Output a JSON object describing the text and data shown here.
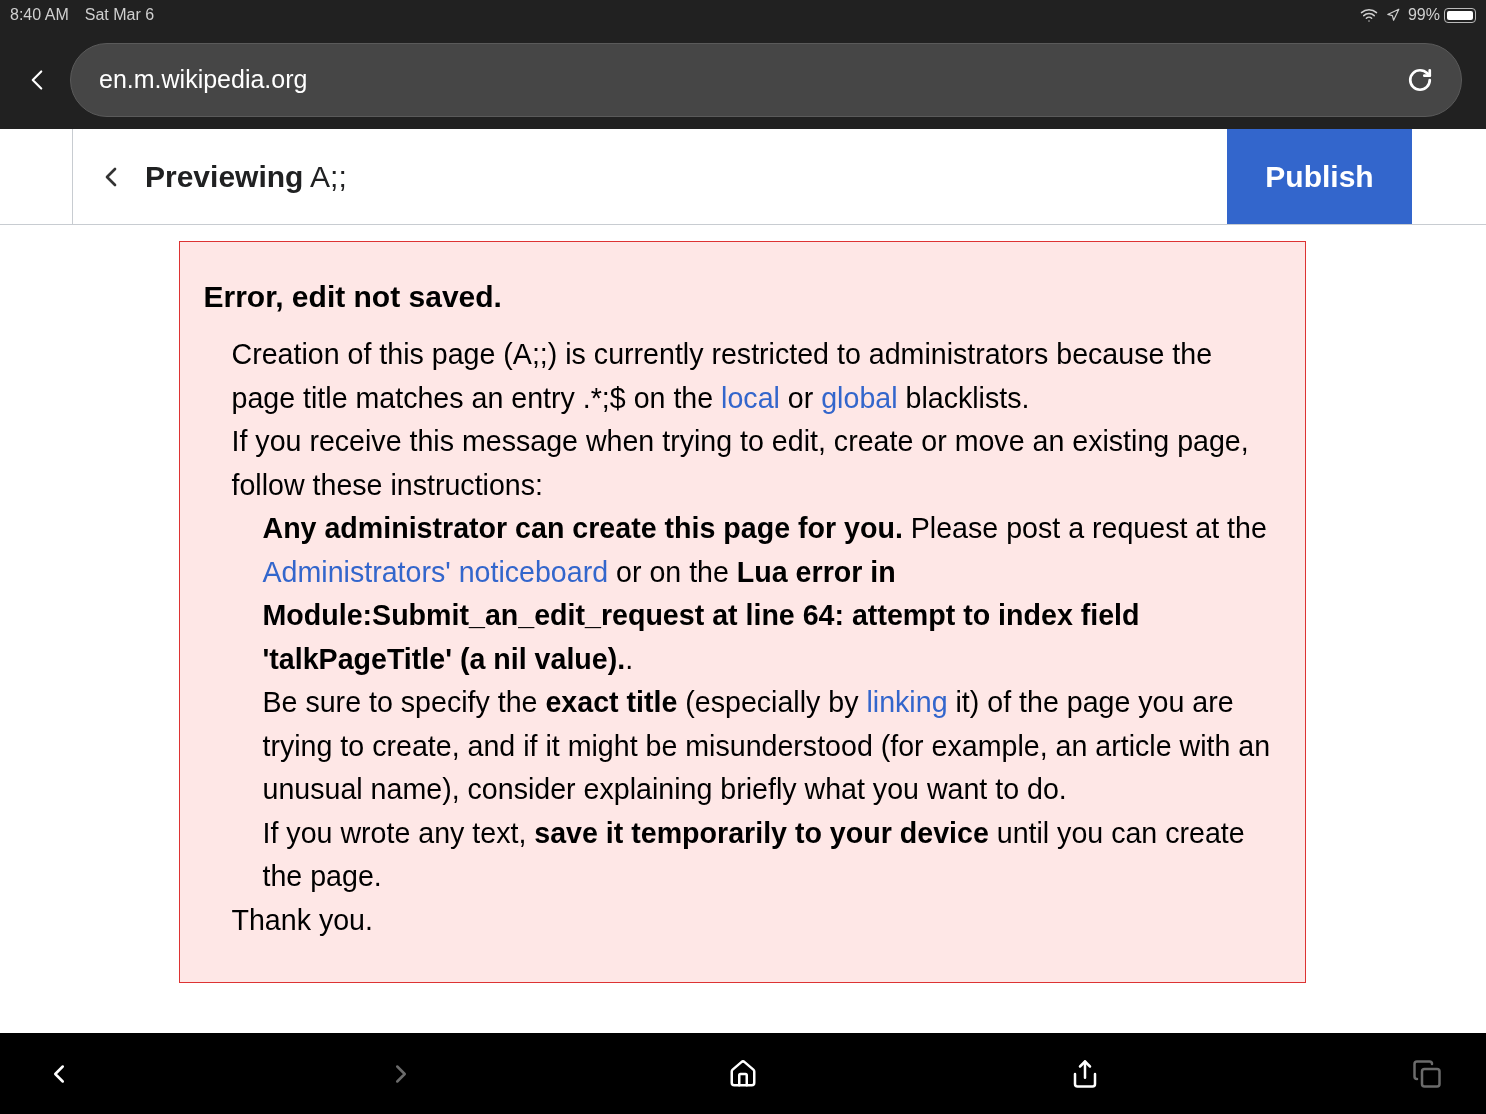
{
  "status_bar": {
    "time": "8:40 AM",
    "date": "Sat Mar 6",
    "battery": "99%"
  },
  "address_bar": {
    "url": "en.m.wikipedia.org"
  },
  "header": {
    "title_bold": "Previewing",
    "title": "A;;",
    "publish": "Publish"
  },
  "error": {
    "heading": "Error, edit not saved.",
    "paragraphs": [
      {
        "segments": [
          {
            "kind": "plain",
            "text": "Creation of this page (A;;) is currently restricted to administrators because the page title matches an entry .*;$ on the "
          },
          {
            "kind": "link",
            "text": "local"
          },
          {
            "kind": "plain",
            "text": " or "
          },
          {
            "kind": "link",
            "text": "global"
          },
          {
            "kind": "plain",
            "text": " blacklists."
          }
        ]
      },
      {
        "segments": [
          {
            "kind": "plain",
            "text": "If you receive this message when trying to edit, create or move an existing page, follow these instructions:"
          }
        ],
        "children": [
          {
            "segments": [
              {
                "kind": "bold",
                "text": "Any administrator can create this page for you."
              },
              {
                "kind": "plain",
                "text": " Please post a request at the "
              },
              {
                "kind": "link",
                "text": "Administrators' noticeboard"
              },
              {
                "kind": "plain",
                "text": " or on the "
              },
              {
                "kind": "bold",
                "text": "Lua error in Module:Submit_an_edit_request at line 64: attempt to index field 'talkPageTitle' (a nil value)."
              },
              {
                "kind": "plain",
                "text": "."
              }
            ]
          },
          {
            "segments": [
              {
                "kind": "plain",
                "text": "Be sure to specify the "
              },
              {
                "kind": "bold",
                "text": "exact title"
              },
              {
                "kind": "plain",
                "text": " (especially by "
              },
              {
                "kind": "link",
                "text": "linking"
              },
              {
                "kind": "plain",
                "text": " it) of the page you are trying to create, and if it might be misunderstood (for example, an article with an unusual name), consider explaining briefly what you want to do."
              }
            ]
          },
          {
            "segments": [
              {
                "kind": "plain",
                "text": "If you wrote any text, "
              },
              {
                "kind": "bold",
                "text": "save it temporarily to your device"
              },
              {
                "kind": "plain",
                "text": " until you can create the page."
              }
            ]
          }
        ]
      },
      {
        "segments": [
          {
            "kind": "plain",
            "text": "Thank you."
          }
        ]
      }
    ]
  },
  "toolbar": [
    {
      "kind": "back",
      "disabled": false
    },
    {
      "kind": "forward",
      "disabled": true
    },
    {
      "kind": "home",
      "disabled": false
    },
    {
      "kind": "share",
      "disabled": false
    },
    {
      "kind": "tabs",
      "disabled": true
    }
  ]
}
